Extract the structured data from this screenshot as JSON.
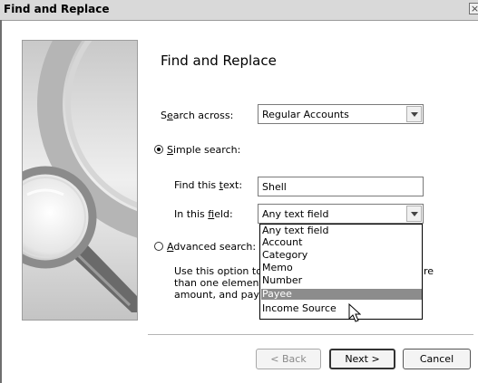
{
  "window": {
    "title": "Find and Replace",
    "close_glyph": "×"
  },
  "illustration": {
    "icon": "magnifier-icon"
  },
  "heading": "Find and Replace",
  "search_across": {
    "label_pre": "S",
    "label_accel": "e",
    "label_post": "arch across:",
    "value": "Regular Accounts"
  },
  "simple_search": {
    "label_accel": "S",
    "label_post": "imple search:",
    "selected": true
  },
  "find_text": {
    "label_pre": "Find this ",
    "label_accel": "t",
    "label_post": "ext:",
    "value": "Shell"
  },
  "in_field": {
    "label_pre": "In this ",
    "label_accel": "f",
    "label_post": "ield:",
    "value": "Any text field",
    "options": [
      "Any text field",
      "Account",
      "Category",
      "Memo",
      "Number",
      "Payee",
      "Income Source"
    ],
    "highlighted": "Payee"
  },
  "advanced_search": {
    "label_accel": "A",
    "label_post": "dvanced search:",
    "selected": false
  },
  "description": {
    "line1_a": "Use this option to s",
    "line1_b": "re",
    "line2": "than one element a",
    "line3": "amount, and payee"
  },
  "buttons": {
    "back": "< Back",
    "next": "Next >",
    "cancel": "Cancel"
  },
  "colors": {
    "highlight": "#8c8c8c",
    "titlebar": "#d9d9d9"
  }
}
